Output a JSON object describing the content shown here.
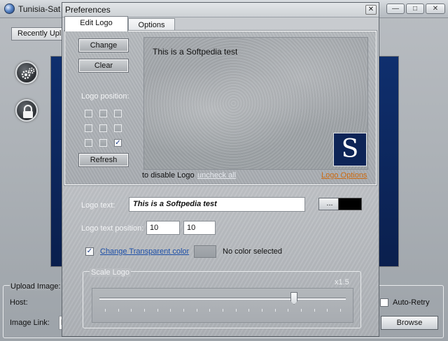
{
  "main_window": {
    "title": "Tunisia-Sat",
    "minimize_glyph": "—",
    "maximize_glyph": "□",
    "close_glyph": "✕",
    "recent_tab_label": "Recently Upl",
    "upload_label": "Upload Image:",
    "host_label": "Host:",
    "image_link_label": "Image Link:",
    "image_link_value": "h",
    "auto_retry_label": "Auto-Retry",
    "browse_label": "Browse",
    "side_icons": [
      "gear-icon",
      "lock-icon"
    ]
  },
  "preferences": {
    "title": "Preferences",
    "close_glyph": "✕",
    "tabs": [
      {
        "label": "Edit Logo",
        "active": true
      },
      {
        "label": "Options",
        "active": false
      }
    ],
    "buttons": {
      "change": "Change",
      "clear": "Clear",
      "refresh": "Refresh"
    },
    "logo_position_label": "Logo position:",
    "logo_position_grid": [
      [
        false,
        false,
        false
      ],
      [
        false,
        false,
        false
      ],
      [
        false,
        false,
        true
      ]
    ],
    "check_glyph": "✓",
    "preview_text": "This is a Softpedia test",
    "preview_logo_letter": "S",
    "disable_text": "to disable Logo",
    "uncheck_all_link": "uncheck all",
    "logo_options_link": "Logo Options",
    "logo_text_label": "Logo text:",
    "logo_text_value": "This is a Softpedia test",
    "font_button_label": "...",
    "logo_text_color": "#000000",
    "logo_text_position_label": "Logo text position:",
    "logo_text_position_x": "10",
    "logo_text_position_y": "10",
    "transparent_checked": true,
    "transparent_link": "Change Transparent color",
    "no_color_text": "No color selected",
    "scale_group_label": "Scale Logo",
    "scale_value": "x1.5",
    "scale_slider_fraction": 0.79
  }
}
